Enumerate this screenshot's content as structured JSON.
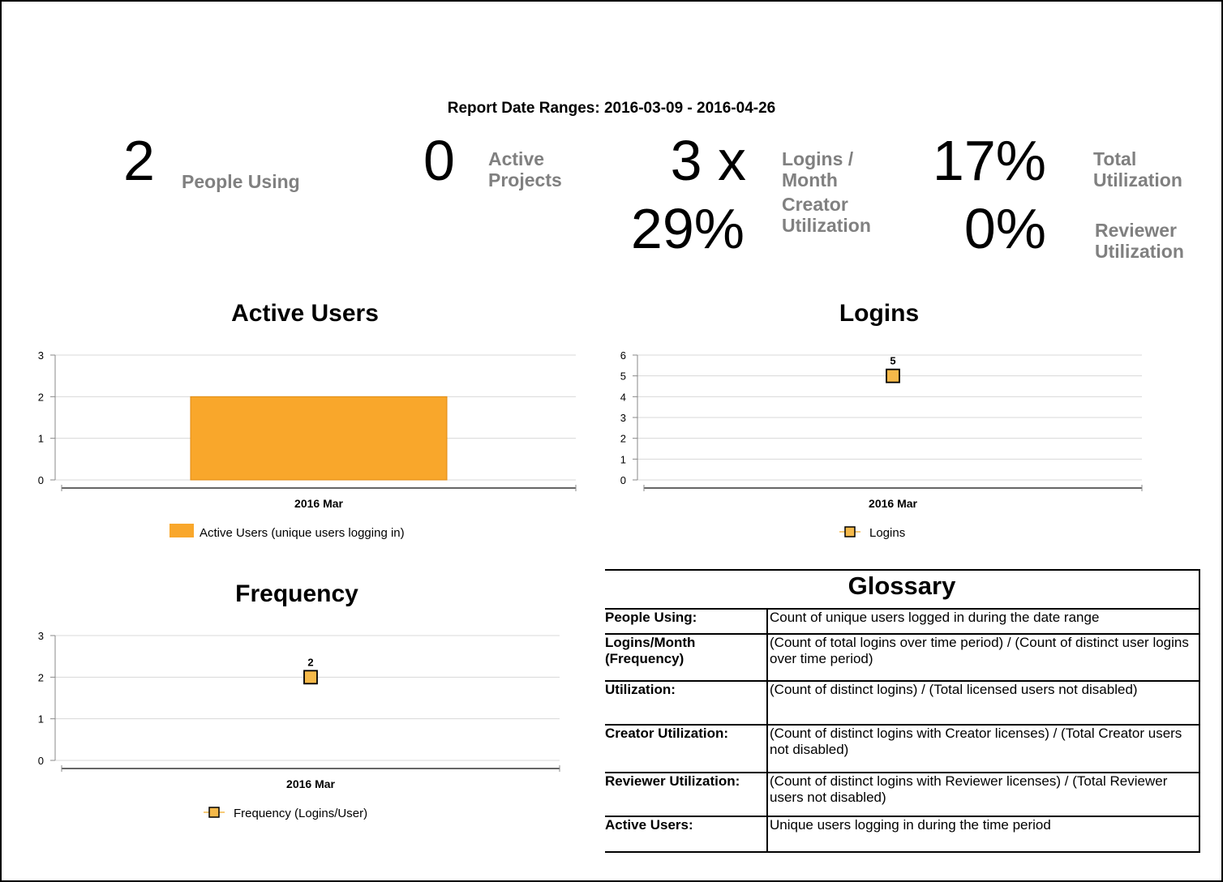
{
  "report_range": "Report Date Ranges: 2016-03-09 - 2016-04-26",
  "kpis": {
    "people_using": {
      "value": "2",
      "label": "People Using"
    },
    "active_projects": {
      "value": "0",
      "label_line1": "Active",
      "label_line2": "Projects"
    },
    "logins_month": {
      "value": "3 x",
      "label_line1": "Logins /",
      "label_line2": "Month"
    },
    "total_utilization": {
      "value": "17%",
      "label_line1": "Total",
      "label_line2": "Utilization"
    },
    "creator_utilization": {
      "value": "29%",
      "label_line1": "Creator",
      "label_line2": "Utilization"
    },
    "reviewer_utilization": {
      "value": "0%",
      "label_line1": "Reviewer",
      "label_line2": "Utilization"
    }
  },
  "chart_data": [
    {
      "type": "bar",
      "title": "Active Users",
      "categories": [
        "2016 Mar"
      ],
      "series": [
        {
          "name": "Active Users (unique users logging in)",
          "values": [
            2
          ]
        }
      ],
      "ylim": [
        0,
        3
      ],
      "yticks": [
        "0",
        "1",
        "2",
        "3"
      ],
      "grid": true,
      "legend": "bottom",
      "color": "#f9a72b"
    },
    {
      "type": "line",
      "title": "Logins",
      "categories": [
        "2016 Mar"
      ],
      "series": [
        {
          "name": "Logins",
          "values": [
            5
          ]
        }
      ],
      "data_labels": [
        "5"
      ],
      "ylim": [
        0,
        6
      ],
      "yticks": [
        "0",
        "1",
        "2",
        "3",
        "4",
        "5",
        "6"
      ],
      "grid": true,
      "legend": "bottom",
      "color": "#f5b94a"
    },
    {
      "type": "line",
      "title": "Frequency",
      "categories": [
        "2016 Mar"
      ],
      "series": [
        {
          "name": "Frequency (Logins/User)",
          "values": [
            2
          ]
        }
      ],
      "data_labels": [
        "2"
      ],
      "ylim": [
        0,
        3
      ],
      "yticks": [
        "0",
        "1",
        "2",
        "3"
      ],
      "grid": true,
      "legend": "bottom",
      "color": "#f5b94a"
    }
  ],
  "glossary": {
    "title": "Glossary",
    "rows": [
      {
        "term": "People Using:",
        "def": "Count of unique users logged in during the date range"
      },
      {
        "term": "Logins/Month (Frequency)",
        "def": "(Count of total logins over time period) / (Count of distinct user logins over time period)"
      },
      {
        "term": "Utilization:",
        "def": "(Count of distinct logins) / (Total licensed users not disabled)"
      },
      {
        "term": "Creator Utilization:",
        "def": "(Count of distinct logins with Creator licenses) / (Total Creator users not disabled)"
      },
      {
        "term": "Reviewer Utilization:",
        "def": "(Count of distinct logins with Reviewer licenses) / (Total Reviewer users not disabled)"
      },
      {
        "term": "Active Users:",
        "def": "Unique users logging in during the time period"
      }
    ]
  }
}
